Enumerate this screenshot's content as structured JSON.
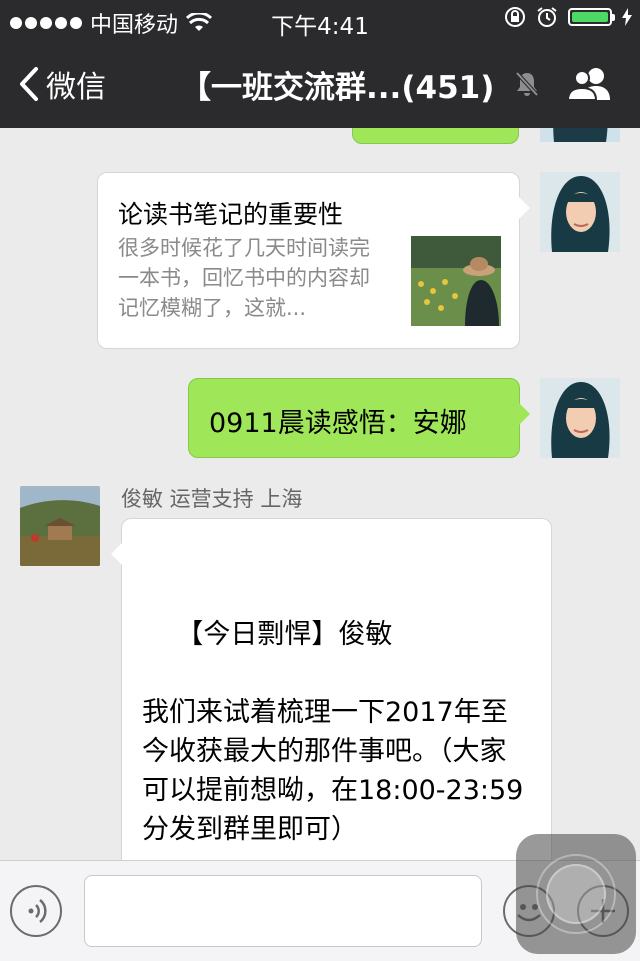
{
  "status_bar": {
    "carrier": "中国移动",
    "time": "下午4:41"
  },
  "nav": {
    "back_label": "微信",
    "title": "【一班交流群...(451)"
  },
  "messages": [
    {
      "type": "link",
      "side": "right",
      "title": "论读书笔记的重要性",
      "description": "很多时候花了几天时间读完一本书，回忆书中的内容却记忆模糊了，这就..."
    },
    {
      "type": "text",
      "side": "right",
      "text": "0911晨读感悟：安娜"
    },
    {
      "type": "text",
      "side": "left",
      "sender": "俊敏 运营支持 上海",
      "text": "【今日剽悍】俊敏\n\n我们来试着梳理一下2017年至今收获最大的那件事吧。（大家可以提前想呦，在18:00-23:59分发到群里即可）"
    }
  ],
  "input_bar": {
    "voice_icon": "voice-icon",
    "emoji_icon": "emoji-icon",
    "plus_icon": "plus-icon"
  },
  "colors": {
    "bar": "#2b2b2d",
    "green_bubble": "#9fe658",
    "background": "#ebebeb",
    "battery": "#4cd964"
  }
}
